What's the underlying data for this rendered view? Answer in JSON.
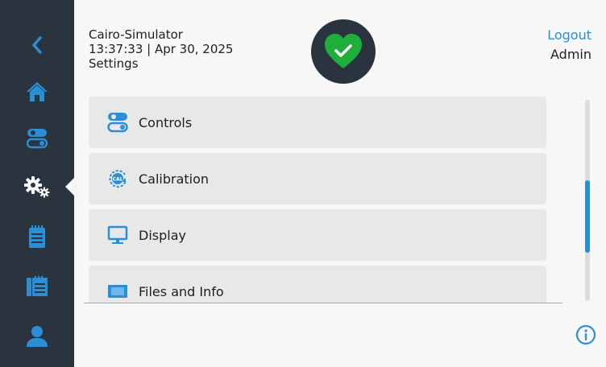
{
  "header": {
    "device_name": "Cairo-Simulator",
    "datetime": "13:37:33 | Apr 30, 2025",
    "page_title": "Settings",
    "logout_label": "Logout",
    "user_name": "Admin",
    "status": "heart-check-icon"
  },
  "sidebar": {
    "items": [
      {
        "icon": "back-chevron-icon"
      },
      {
        "icon": "home-icon"
      },
      {
        "icon": "toggles-icon"
      },
      {
        "icon": "settings-gears-icon",
        "active": true
      },
      {
        "icon": "notepad-icon"
      },
      {
        "icon": "files-icon"
      },
      {
        "icon": "user-icon"
      }
    ]
  },
  "menu": {
    "items": [
      {
        "label": "Controls",
        "icon": "toggles-icon"
      },
      {
        "label": "Calibration",
        "icon": "calibration-icon"
      },
      {
        "label": "Display",
        "icon": "monitor-icon"
      },
      {
        "label": "Files and Info",
        "icon": "files-info-icon"
      }
    ]
  },
  "scrollbar": {
    "position_fraction": 0.4
  },
  "colors": {
    "sidebar_bg": "#2a343f",
    "accent_blue": "#2b8fd6",
    "status_green": "#1fae3a",
    "item_bg": "#e8e8e8"
  }
}
